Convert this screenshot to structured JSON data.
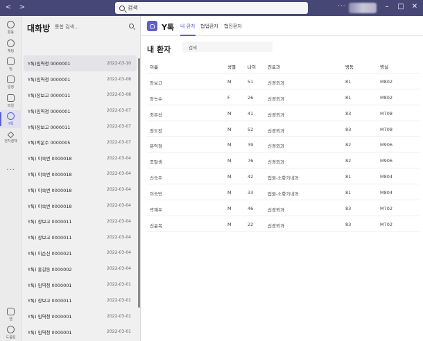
{
  "titlebar": {
    "search_placeholder": "검색",
    "more": "···",
    "back": "<",
    "forward": ">",
    "minimize": "–",
    "maximize": "□",
    "close": "✕"
  },
  "rail": {
    "items": [
      {
        "label": "활동",
        "icon": "bell-icon"
      },
      {
        "label": "채팅",
        "icon": "chat-icon"
      },
      {
        "label": "팀",
        "icon": "teams-icon"
      },
      {
        "label": "일정",
        "icon": "calendar-icon"
      },
      {
        "label": "파일",
        "icon": "file-icon"
      },
      {
        "label": "Y톡",
        "icon": "people-icon"
      },
      {
        "label": "전자결재",
        "icon": "pen-icon"
      }
    ],
    "more": "···",
    "apps_label": "앱",
    "help_label": "도움말"
  },
  "chats": {
    "title": "대화방",
    "search_placeholder": "통합 검색...",
    "rows": [
      {
        "name": "Y톡)임역청 0000001",
        "date": "2022-03-10"
      },
      {
        "name": "Y톡)임역청 0000001",
        "date": "2022-03-08"
      },
      {
        "name": "Y톡)장보고 0000011",
        "date": "2022-03-08"
      },
      {
        "name": "Y톡)임역청 0000001",
        "date": "2022-03-07"
      },
      {
        "name": "Y톡)장보고 0000011",
        "date": "2022-03-07"
      },
      {
        "name": "Y톡)박운수 0000005",
        "date": "2022-03-07"
      },
      {
        "name": "Y톡) 이숙번 0000018",
        "date": "2022-03-04"
      },
      {
        "name": "Y톡) 이숙번 0000018",
        "date": "2022-03-04"
      },
      {
        "name": "Y톡) 이숙번 0000018",
        "date": "2022-03-04"
      },
      {
        "name": "Y톡) 이숙번 0000018",
        "date": "2022-03-04"
      },
      {
        "name": "Y톡) 장보고 0000011",
        "date": "2022-03-04"
      },
      {
        "name": "Y톡) 장보고 0000011",
        "date": "2022-03-04"
      },
      {
        "name": "Y톡) 이순신 0000021",
        "date": "2022-03-04"
      },
      {
        "name": "Y톡) 홍길동 0000002",
        "date": "2022-03-04"
      },
      {
        "name": "Y톡) 임역청 0000001",
        "date": "2022-03-01"
      },
      {
        "name": "Y톡) 장보고 0000011",
        "date": "2022-03-01"
      },
      {
        "name": "Y톡) 임역청 0000001",
        "date": "2022-03-01"
      },
      {
        "name": "Y톡) 임역청 0000001",
        "date": "2022-03-01"
      },
      {
        "name": "Y톡) 임역청 0000001",
        "date": "2022-03-01"
      }
    ]
  },
  "main": {
    "app_name": "Y톡",
    "tabs": [
      "내 환자",
      "협업환자",
      "협진환자"
    ],
    "page_title": "내 환자",
    "search_placeholder": "검색",
    "columns": [
      "이름",
      "성별",
      "나이",
      "진료과",
      "병동",
      "병실"
    ],
    "patients": [
      [
        "장보고",
        "M",
        "51",
        "신경외과",
        "81",
        "M802"
      ],
      [
        "장녹수",
        "F",
        "26",
        "신경외과",
        "81",
        "M802"
      ],
      [
        "최무선",
        "M",
        "41",
        "신경외과",
        "83",
        "M708"
      ],
      [
        "정도전",
        "M",
        "52",
        "신경외과",
        "83",
        "M708"
      ],
      [
        "문익점",
        "M",
        "39",
        "신경외과",
        "82",
        "M906"
      ],
      [
        "조말생",
        "M",
        "76",
        "신경외과",
        "82",
        "M906"
      ],
      [
        "신숙주",
        "M",
        "42",
        "입원-소화기내과",
        "81",
        "M804"
      ],
      [
        "이숙번",
        "M",
        "33",
        "입원-소화기내과",
        "81",
        "M804"
      ],
      [
        "곽재우",
        "M",
        "46",
        "신경외과",
        "83",
        "M702"
      ],
      [
        "신윤복",
        "M",
        "22",
        "신경외과",
        "83",
        "M702"
      ]
    ]
  },
  "colors": {
    "titlebar": "#464775",
    "accent": "#5b5fc7"
  }
}
